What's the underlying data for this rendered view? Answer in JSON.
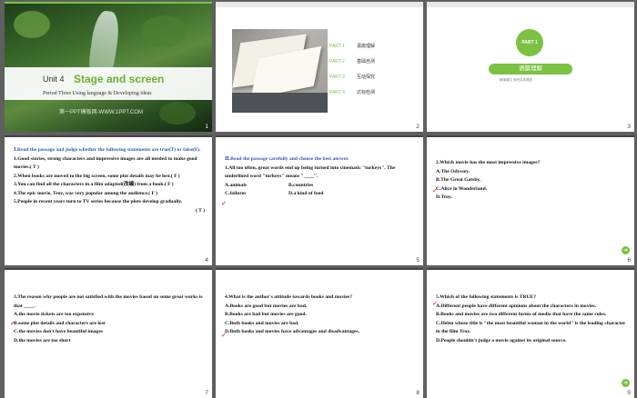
{
  "slides": [
    {
      "num": "1",
      "unit": "Unit 4",
      "title": "Stage and screen",
      "period": "Period Three   Using language & Developing ideas",
      "watermark": "第一PPT模板网-WWW.1PPT.COM"
    },
    {
      "num": "2",
      "parts": [
        {
          "label": "PART 1",
          "text": "语篇理解"
        },
        {
          "label": "PART 2",
          "text": "基础自测"
        },
        {
          "label": "PART 3",
          "text": "互动探究"
        },
        {
          "label": "PART 4",
          "text": "达标检测"
        }
      ]
    },
    {
      "num": "3",
      "circle": "PART 1",
      "pill": "语篇理解",
      "sub": "精读课文    深挖文本理念"
    },
    {
      "num": "4",
      "heading": "Ⅰ.Read the passage and judge whether the following statements are true(T) or false(F).",
      "lines": [
        "1.Good stories, strong characters and impressive images are all needed to make good movies.( T )",
        "2.When books are moved to the big screen, some plot details may be lost.( F )",
        "3.You can find all the characters in a film adapted(改编) from a book.( F )",
        "4.The epic movie, Troy, was very popular among the audience.( F )",
        "5.People in recent years turn to TV series because the plots develop gradually.",
        "( T )"
      ],
      "marks": [
        "T",
        "F",
        "F",
        "F",
        "T"
      ]
    },
    {
      "num": "5",
      "heading": "Ⅱ.Read the passage carefully and choose the best answer.",
      "question": "1.All too often, great words end up being turned into cinematic \"turkeys\". The underlined word \"turkeys\" means \"____\".",
      "options": [
        "A.animals",
        "B.countries",
        "C.failures",
        "D.a kind of food"
      ],
      "answer": "C"
    },
    {
      "num": "6",
      "question": "2.Which movie has the most impressive images?",
      "options": [
        "A.The Odyssey.",
        "B.The Great Gatsby.",
        "C.Alice in Wonderland.",
        "D.Troy."
      ],
      "answer": "C"
    },
    {
      "num": "7",
      "question": "3.The reason why people are not satisfied with the movies based on some great works is that ____.",
      "options": [
        "A.the movie tickets are too expensive",
        "B.some plot details and characters are lost",
        "C.the movies don't have beautiful images",
        "D.the movies are too short"
      ],
      "answer": "B"
    },
    {
      "num": "8",
      "question": "4.What is the author's attitude towards books and movies?",
      "options": [
        "A.Books are good but movies are bad.",
        "B.Books are bad but movies are good.",
        "C.Both books and movies are bad.",
        "D.Both books and movies have advantages and disadvantages."
      ],
      "answer": "D"
    },
    {
      "num": "9",
      "question": "5.Which of the following statements is TRUE?",
      "options": [
        "A.Different people have different opinions about the characters in movies.",
        "B.Books and movies are two different forms of media that have the same rules.",
        "C.Helen whose title is \"the most beautiful woman in the world\" is the leading character in the film Troy.",
        "D.People shouldn't judge a movie against its original source."
      ],
      "answer": "A"
    }
  ],
  "colors": {
    "accent": "#7cc242",
    "mark": "#e84c3d",
    "heading_blue": "#2e55b5"
  }
}
